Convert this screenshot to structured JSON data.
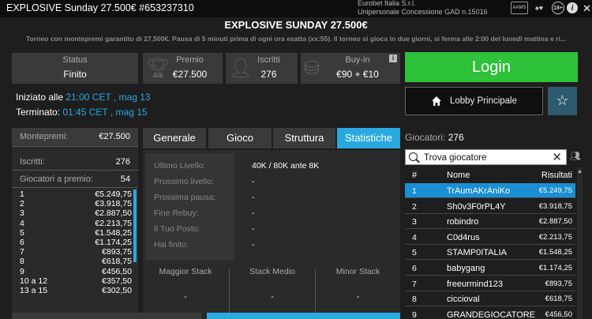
{
  "window": {
    "title": "EXPLOSIVE Sunday 27.500€ #653237310",
    "company_line1": "Eurobet Italia S.r.l.",
    "company_line2": "Unipersonale Concessione GAD n.15016",
    "aams_label": "AAMS",
    "age_label": "18+",
    "info_icon": "info-icon",
    "close_icon": "close-icon"
  },
  "tournament": {
    "name": "EXPLOSIVE SUNDAY 27.500€",
    "description": "Torneo con montepremi garantito di 27,500€. Pausa di 5 minuti prima di ogni ora esatta (xx:55). Il torneo si gioca in due giorni, si ferma alle 2:00 del lunedì mattina e ri..."
  },
  "cards": {
    "status_label": "Status",
    "status_value": "Finito",
    "premio_label": "Premio",
    "premio_value": "€27.500",
    "iscritti_label": "Iscritti",
    "iscritti_value": "276",
    "buyin_label": "Buy-in",
    "buyin_value": "€90 + €10",
    "buyin_info": "i"
  },
  "actions": {
    "login_label": "Login",
    "lobby_label": "Lobby Principale",
    "star_icon": "star-icon"
  },
  "times": {
    "start_label": "Iniziato alle",
    "start_value": "21:00 CET , mag 13",
    "end_label": "Terminato:",
    "end_value": "01:45 CET , mag 15"
  },
  "left_panel": {
    "montepremi_label": "Montepremi:",
    "montepremi_value": "€27.500",
    "iscritti_label": "Iscritti:",
    "iscritti_value": "276",
    "giocatori_label": "Giocatori a premio:",
    "giocatori_value": "54",
    "prizes": [
      {
        "pos": "1",
        "amount": "€5.249,75"
      },
      {
        "pos": "2",
        "amount": "€3.918,75"
      },
      {
        "pos": "3",
        "amount": "€2.887,50"
      },
      {
        "pos": "4",
        "amount": "€2.213,75"
      },
      {
        "pos": "5",
        "amount": "€1.548,25"
      },
      {
        "pos": "6",
        "amount": "€1.174,25"
      },
      {
        "pos": "7",
        "amount": "€893,75"
      },
      {
        "pos": "8",
        "amount": "€618,75"
      },
      {
        "pos": "9",
        "amount": "€456,50"
      },
      {
        "pos": "10 a 12",
        "amount": "€357,50"
      },
      {
        "pos": "13 a 15",
        "amount": "€302,50"
      }
    ]
  },
  "tabs": [
    "Generale",
    "Gioco",
    "Struttura",
    "Statistiche"
  ],
  "stats": {
    "rows": [
      {
        "key": "Ultimo Livello:",
        "value": "40K / 80K ante 8K"
      },
      {
        "key": "Prossimo livello:",
        "value": "-"
      },
      {
        "key": "Prossima pausa:",
        "value": "-"
      },
      {
        "key": "Fine Rebuy:",
        "value": "-"
      },
      {
        "key": "Il Tuo Posto:",
        "value": "-"
      },
      {
        "key": "Hai finito:",
        "value": "-"
      }
    ],
    "maggior_label": "Maggior Stack",
    "maggior_value": "-",
    "medio_label": "Stack Medio",
    "medio_value": "-",
    "minor_label": "Minor Stack",
    "minor_value": "-"
  },
  "players": {
    "header_label": "Giocatori:",
    "header_count": "276",
    "search_value": "Trova giocatore",
    "col_rank": "#",
    "col_name": "Nome",
    "col_result": "Risultati",
    "rows": [
      {
        "rank": "1",
        "name": "TrAumAKrAniKo",
        "result": "€5.249,75"
      },
      {
        "rank": "2",
        "name": "Sh0v3F0rPL4Y",
        "result": "€3.918,75"
      },
      {
        "rank": "3",
        "name": "robindro",
        "result": "€2.887,50"
      },
      {
        "rank": "4",
        "name": "C0d4rus",
        "result": "€2.213,75"
      },
      {
        "rank": "5",
        "name": "STAMP0ITALIA",
        "result": "€1.548,25"
      },
      {
        "rank": "6",
        "name": "babygang",
        "result": "€1.174,25"
      },
      {
        "rank": "7",
        "name": "freeurmind123",
        "result": "€893,75"
      },
      {
        "rank": "8",
        "name": "ciccioval",
        "result": "€618,75"
      },
      {
        "rank": "9",
        "name": "GRANDEGIOCATORE",
        "result": "€456,50"
      }
    ]
  },
  "colors": {
    "accent": "#2aa9e0",
    "login": "#2ec13a",
    "selected_row": "#1a8fd4"
  }
}
